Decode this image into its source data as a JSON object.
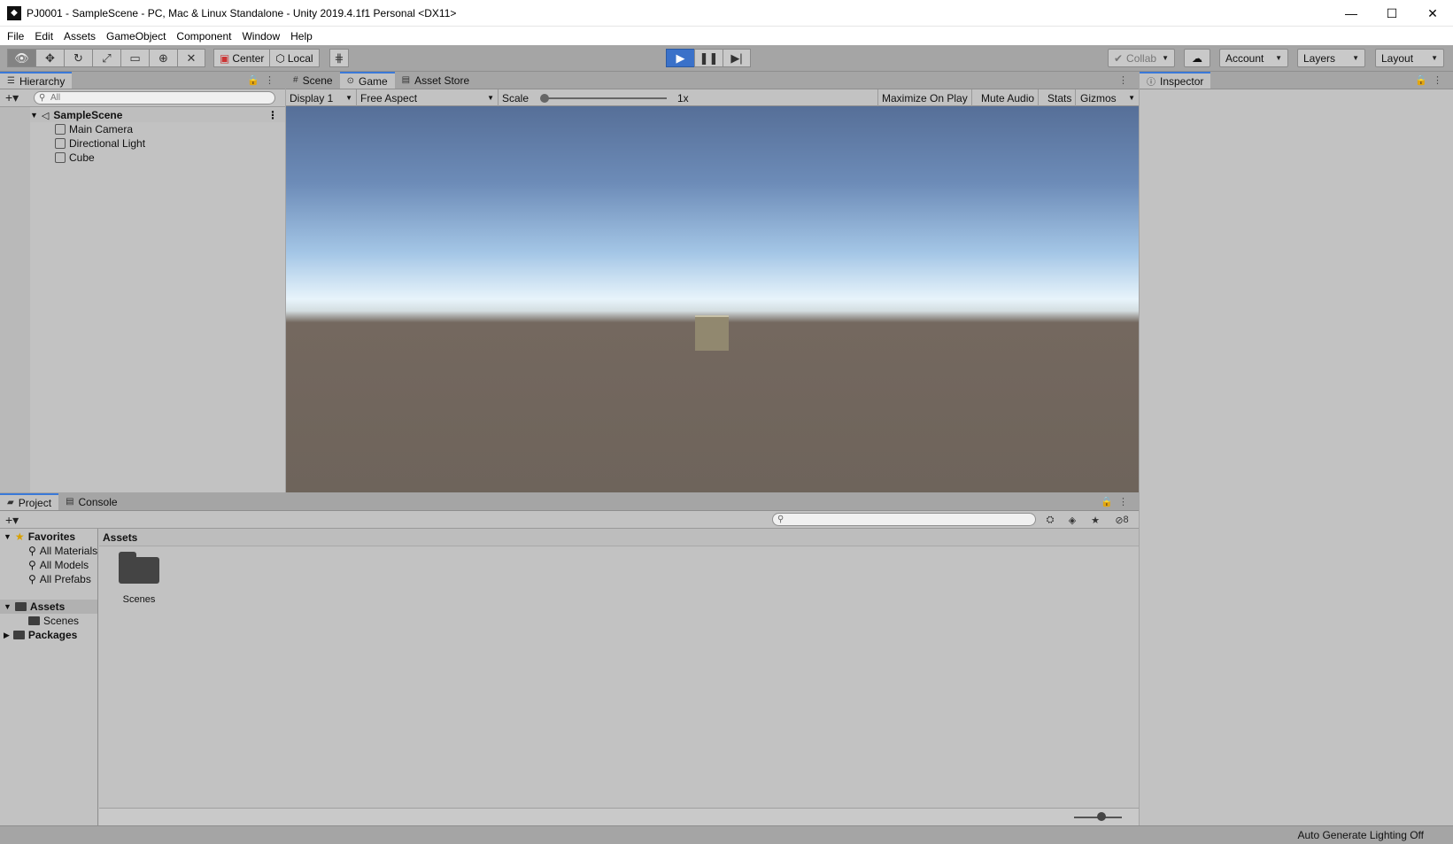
{
  "window": {
    "title": "PJ0001 - SampleScene - PC, Mac & Linux Standalone - Unity 2019.4.1f1 Personal <DX11>",
    "minimize_glyph": "—",
    "maximize_glyph": "☐",
    "close_glyph": "✕"
  },
  "menu": [
    "File",
    "Edit",
    "Assets",
    "GameObject",
    "Component",
    "Window",
    "Help"
  ],
  "toolbar": {
    "pivot_label": "Center",
    "space_label": "Local",
    "collab_label": "Collab",
    "account_label": "Account",
    "layers_label": "Layers",
    "layout_label": "Layout"
  },
  "hierarchy": {
    "tab_label": "Hierarchy",
    "search_placeholder": "All",
    "scene_name": "SampleScene",
    "objects": [
      "Main Camera",
      "Directional Light",
      "Cube"
    ]
  },
  "center_tabs": {
    "scene": "Scene",
    "game": "Game",
    "asset_store": "Asset Store"
  },
  "game_toolbar": {
    "display": "Display 1",
    "aspect": "Free Aspect",
    "scale_label": "Scale",
    "scale_value": "1x",
    "maximize_on_play": "Maximize On Play",
    "mute_audio": "Mute Audio",
    "stats": "Stats",
    "gizmos": "Gizmos"
  },
  "inspector": {
    "tab_label": "Inspector"
  },
  "project": {
    "tab_label": "Project",
    "console_tab_label": "Console",
    "hidden_count": "8",
    "favorites_label": "Favorites",
    "favorites": [
      "All Materials",
      "All Models",
      "All Prefabs"
    ],
    "assets_label": "Assets",
    "asset_folders": [
      "Scenes"
    ],
    "packages_label": "Packages",
    "breadcrumb": "Assets",
    "grid_items": [
      "Scenes"
    ]
  },
  "status": {
    "lighting": "Auto Generate Lighting Off"
  },
  "colors": {
    "accent": "#3a79d8",
    "play_button": "#3a71c9",
    "panel_bg": "#c2c2c2",
    "chrome_bg": "#a5a5a5"
  }
}
